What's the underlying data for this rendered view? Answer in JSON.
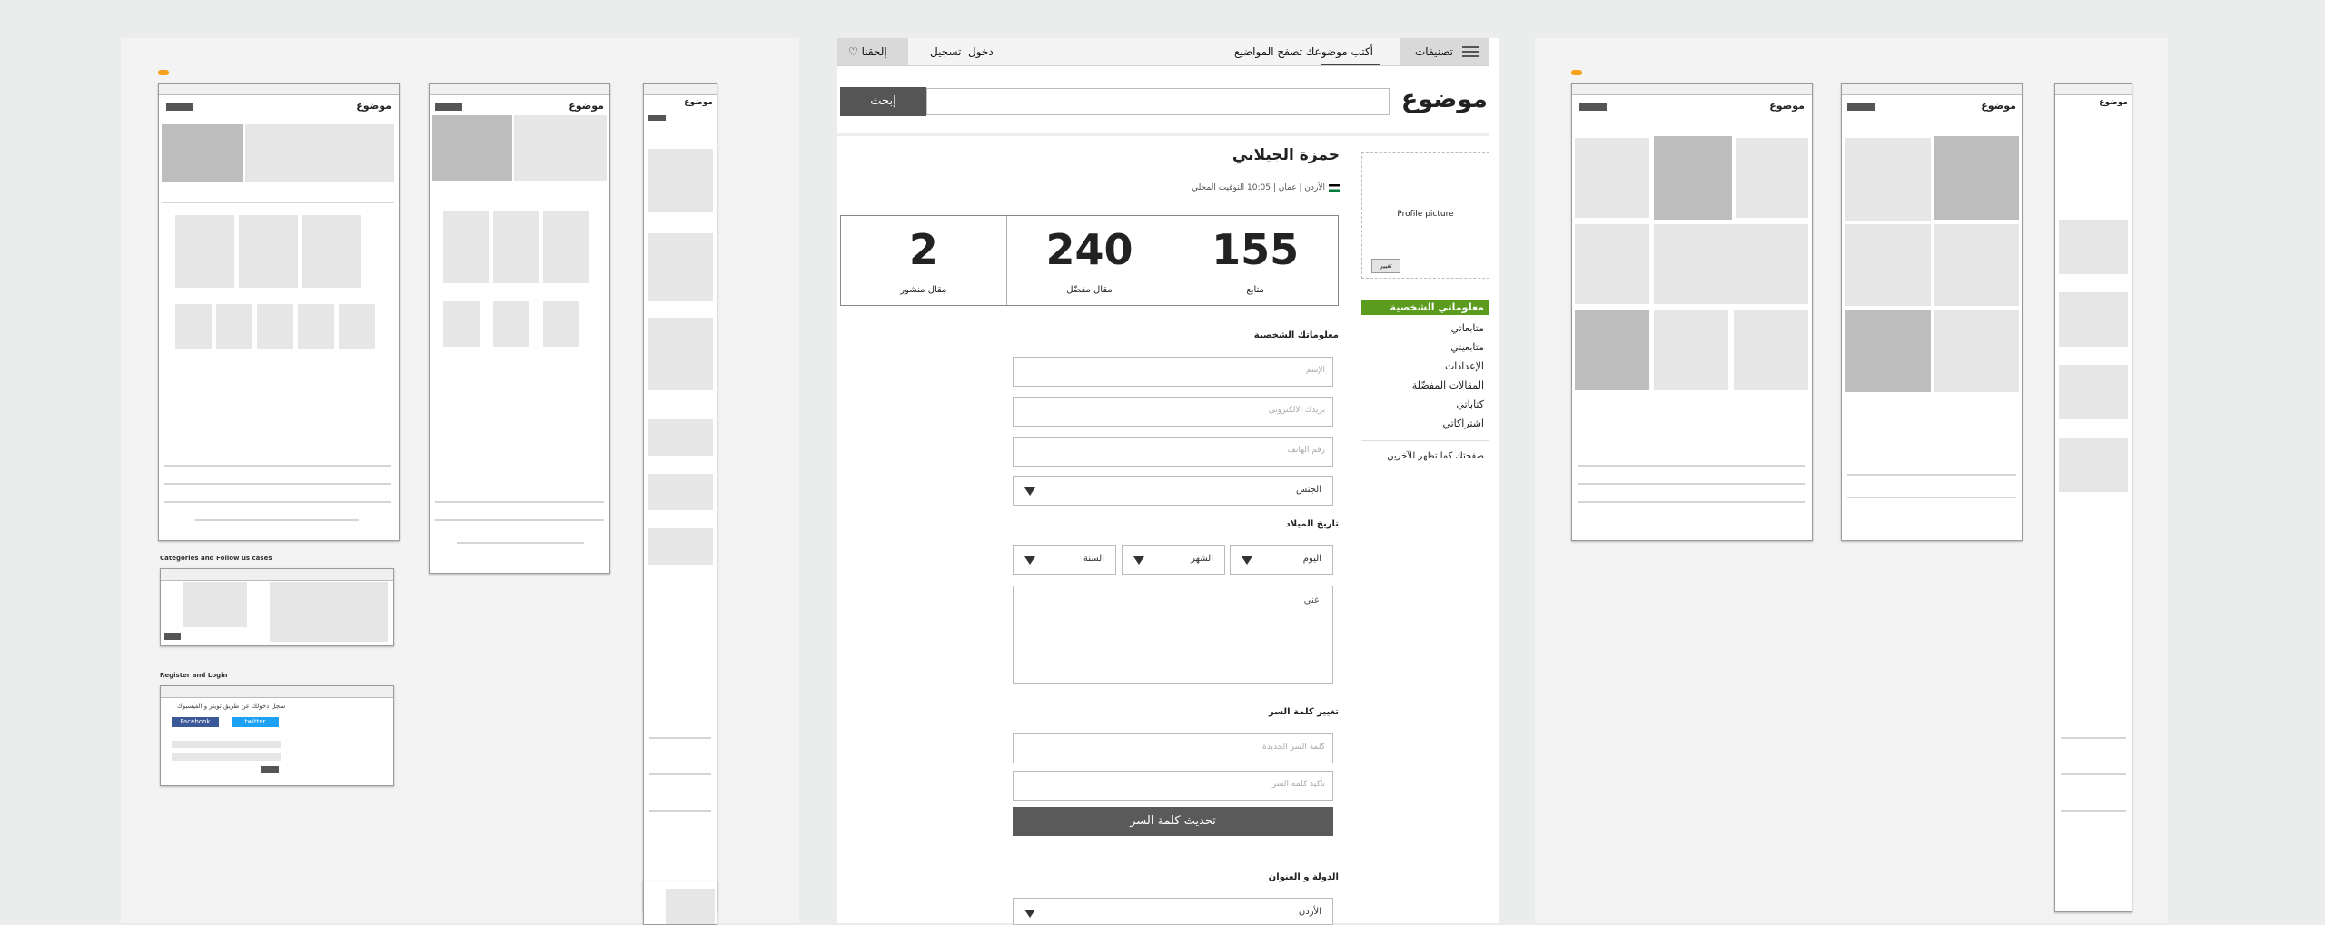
{
  "nav": {
    "categories": "تصنيفات",
    "write_topic": "أكتب موضوعك",
    "browse_topics": "تصفح المواضيع",
    "register": "تسجيل",
    "login": "دخول",
    "join_us": "إلحقنا"
  },
  "logo": "موضوع",
  "search": {
    "button": "إبحث",
    "placeholder": ""
  },
  "profile": {
    "picture_label": "Profile picture",
    "change_button": "تغيير",
    "name": "حمزة الجيلاني",
    "location": "الأردن | عمان | 10:05 التوقيت المحلي"
  },
  "stats": [
    {
      "value": "155",
      "label": "متابع"
    },
    {
      "value": "240",
      "label": "مقال مفضّل"
    },
    {
      "value": "2",
      "label": "مقال منشور"
    }
  ],
  "side_menu": {
    "items": [
      "معلوماتي الشخصية",
      "متابعاتي",
      "متابعيني",
      "الإعدادات",
      "المقالات المفضّلة",
      "كتاباتي",
      "اشتراكاتي"
    ],
    "public_view": "صفحتك كما تظهر للآخرين"
  },
  "form": {
    "personal_title": "معلوماتك الشخصية",
    "name_ph": "الإسم",
    "email_ph": "بريدك الالكتروني",
    "phone_ph": "رقم الهاتف",
    "gender": "الجنس",
    "birthdate_title": "تاريخ الميلاد",
    "day": "اليوم",
    "month": "الشهر",
    "year": "السنة",
    "about_ph": "عني",
    "password_title": "تغيير كلمة السر",
    "new_password_ph": "كلمة السر الجديدة",
    "confirm_password_ph": "تأكيد كلمة السر",
    "update_button": "تحديث كلمة السر",
    "country_title": "الدولة و العنوان",
    "country_value": "الأردن"
  },
  "left_board": {
    "section_categories": "Categories and Follow us cases",
    "section_register": "Register and Login",
    "facebook": "Facebook",
    "twitter": "twitter",
    "social_login": "سجل دخولك عن طريق تويتر و الفيسبوك"
  },
  "colors": {
    "active_menu": "#5b9b1e",
    "facebook": "#3b5998",
    "twitter": "#1da1f2",
    "badge": "#f7a21a"
  }
}
